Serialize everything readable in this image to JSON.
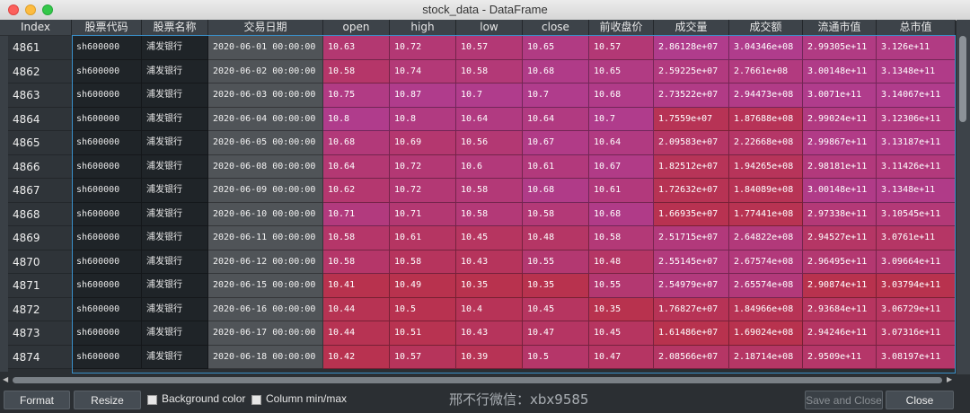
{
  "window": {
    "title": "stock_data - DataFrame"
  },
  "columns": [
    "Index",
    "股票代码",
    "股票名称",
    "交易日期",
    "open",
    "high",
    "low",
    "close",
    "前收盘价",
    "成交量",
    "成交额",
    "流通市值",
    "总市值"
  ],
  "rows": [
    {
      "index": "4861",
      "cells": [
        "sh600000",
        "浦发银行",
        "2020-06-01 00:00:00",
        "10.63",
        "10.72",
        "10.57",
        "10.65",
        "10.57",
        "2.86128e+07",
        "3.04346e+08",
        "2.99305e+11",
        "3.126e+11"
      ]
    },
    {
      "index": "4862",
      "cells": [
        "sh600000",
        "浦发银行",
        "2020-06-02 00:00:00",
        "10.58",
        "10.74",
        "10.58",
        "10.68",
        "10.65",
        "2.59225e+07",
        "2.7661e+08",
        "3.00148e+11",
        "3.1348e+11"
      ]
    },
    {
      "index": "4863",
      "cells": [
        "sh600000",
        "浦发银行",
        "2020-06-03 00:00:00",
        "10.75",
        "10.87",
        "10.7",
        "10.7",
        "10.68",
        "2.73522e+07",
        "2.94473e+08",
        "3.0071e+11",
        "3.14067e+11"
      ]
    },
    {
      "index": "4864",
      "cells": [
        "sh600000",
        "浦发银行",
        "2020-06-04 00:00:00",
        "10.8",
        "10.8",
        "10.64",
        "10.64",
        "10.7",
        "1.7559e+07",
        "1.87688e+08",
        "2.99024e+11",
        "3.12306e+11"
      ]
    },
    {
      "index": "4865",
      "cells": [
        "sh600000",
        "浦发银行",
        "2020-06-05 00:00:00",
        "10.68",
        "10.69",
        "10.56",
        "10.67",
        "10.64",
        "2.09583e+07",
        "2.22668e+08",
        "2.99867e+11",
        "3.13187e+11"
      ]
    },
    {
      "index": "4866",
      "cells": [
        "sh600000",
        "浦发银行",
        "2020-06-08 00:00:00",
        "10.64",
        "10.72",
        "10.6",
        "10.61",
        "10.67",
        "1.82512e+07",
        "1.94265e+08",
        "2.98181e+11",
        "3.11426e+11"
      ]
    },
    {
      "index": "4867",
      "cells": [
        "sh600000",
        "浦发银行",
        "2020-06-09 00:00:00",
        "10.62",
        "10.72",
        "10.58",
        "10.68",
        "10.61",
        "1.72632e+07",
        "1.84089e+08",
        "3.00148e+11",
        "3.1348e+11"
      ]
    },
    {
      "index": "4868",
      "cells": [
        "sh600000",
        "浦发银行",
        "2020-06-10 00:00:00",
        "10.71",
        "10.71",
        "10.58",
        "10.58",
        "10.68",
        "1.66935e+07",
        "1.77441e+08",
        "2.97338e+11",
        "3.10545e+11"
      ]
    },
    {
      "index": "4869",
      "cells": [
        "sh600000",
        "浦发银行",
        "2020-06-11 00:00:00",
        "10.58",
        "10.61",
        "10.45",
        "10.48",
        "10.58",
        "2.51715e+07",
        "2.64822e+08",
        "2.94527e+11",
        "3.0761e+11"
      ]
    },
    {
      "index": "4870",
      "cells": [
        "sh600000",
        "浦发银行",
        "2020-06-12 00:00:00",
        "10.58",
        "10.58",
        "10.43",
        "10.55",
        "10.48",
        "2.55145e+07",
        "2.67574e+08",
        "2.96495e+11",
        "3.09664e+11"
      ]
    },
    {
      "index": "4871",
      "cells": [
        "sh600000",
        "浦发银行",
        "2020-06-15 00:00:00",
        "10.41",
        "10.49",
        "10.35",
        "10.35",
        "10.55",
        "2.54979e+07",
        "2.65574e+08",
        "2.90874e+11",
        "3.03794e+11"
      ]
    },
    {
      "index": "4872",
      "cells": [
        "sh600000",
        "浦发银行",
        "2020-06-16 00:00:00",
        "10.44",
        "10.5",
        "10.4",
        "10.45",
        "10.35",
        "1.76827e+07",
        "1.84966e+08",
        "2.93684e+11",
        "3.06729e+11"
      ]
    },
    {
      "index": "4873",
      "cells": [
        "sh600000",
        "浦发银行",
        "2020-06-17 00:00:00",
        "10.44",
        "10.51",
        "10.43",
        "10.47",
        "10.45",
        "1.61486e+07",
        "1.69024e+08",
        "2.94246e+11",
        "3.07316e+11"
      ]
    },
    {
      "index": "4874",
      "cells": [
        "sh600000",
        "浦发银行",
        "2020-06-18 00:00:00",
        "10.42",
        "10.57",
        "10.39",
        "10.5",
        "10.47",
        "2.08566e+07",
        "2.18714e+08",
        "2.9509e+11",
        "3.08197e+11"
      ]
    }
  ],
  "toolbar": {
    "format_label": "Format",
    "resize_label": "Resize",
    "background_color_label": "Background color",
    "column_minmax_label": "Column min/max",
    "save_close_label": "Save and Close",
    "close_label": "Close"
  },
  "watermark": "邢不行微信：xbx9585",
  "colors": {
    "heat_high": "#b03c8c",
    "heat_low": "#b8324e",
    "selection_border": "#3a8fc8",
    "header_bg": "#3d4349"
  }
}
